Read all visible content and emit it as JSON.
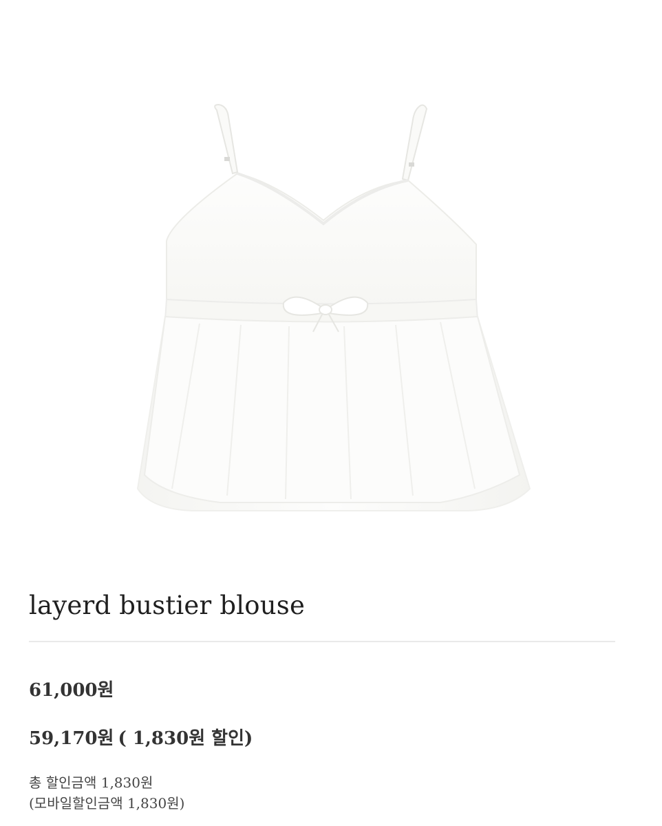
{
  "product": {
    "image_subject": "white-bustier-blouse-photo",
    "title": "layerd bustier blouse",
    "price_original": "61,000원",
    "price_sale": "59,170원",
    "discount_note": "( 1,830원 할인)",
    "discount_total": "총 할인금액 1,830원",
    "discount_mobile": "(모바일할인금액 1,830원)"
  },
  "colors": {
    "text_primary": "#222222",
    "divider": "#e9e9e9",
    "garment_white": "#fbfbf9",
    "garment_shadow": "#e8e8e4"
  }
}
